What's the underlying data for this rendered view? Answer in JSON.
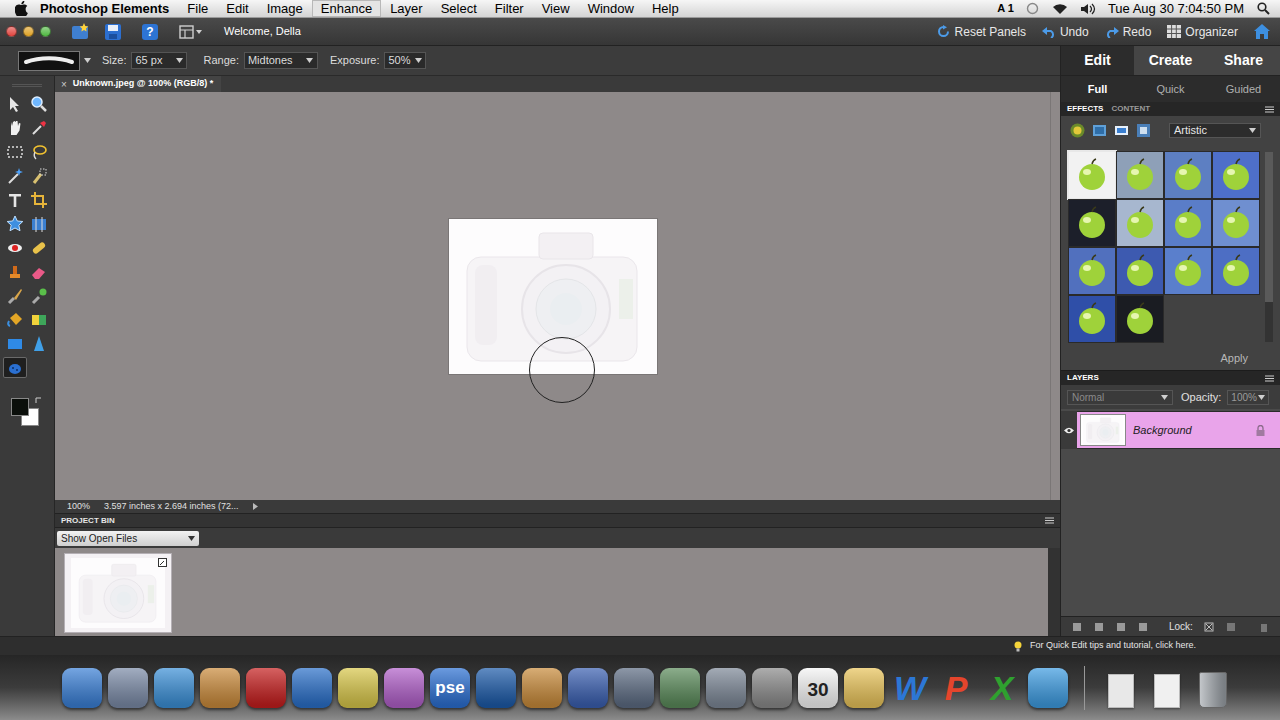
{
  "menubar": {
    "items": [
      {
        "label": "Photoshop Elements",
        "selected": false
      },
      {
        "label": "File",
        "selected": false
      },
      {
        "label": "Edit",
        "selected": false
      },
      {
        "label": "Image",
        "selected": false
      },
      {
        "label": "Enhance",
        "selected": true
      },
      {
        "label": "Layer",
        "selected": false
      },
      {
        "label": "Select",
        "selected": false
      },
      {
        "label": "Filter",
        "selected": false
      },
      {
        "label": "View",
        "selected": false
      },
      {
        "label": "Window",
        "selected": false
      },
      {
        "label": "Help",
        "selected": false
      }
    ],
    "status": "A 1",
    "clock": "Tue Aug 30 7:04:50 PM"
  },
  "app_bar": {
    "help": "?",
    "welcome": "Welcome, Della",
    "reset": "Reset Panels",
    "undo": "Undo",
    "redo": "Redo",
    "organizer": "Organizer"
  },
  "options": {
    "size_label": "Size:",
    "size": "65 px",
    "range_label": "Range:",
    "range": "Midtones",
    "exposure_label": "Exposure:",
    "exposure": "50%"
  },
  "tools": [
    {
      "selected": false
    },
    {
      "selected": false
    },
    {
      "selected": false
    },
    {
      "selected": false
    },
    {
      "selected": false
    },
    {
      "selected": false
    },
    {
      "selected": false
    },
    {
      "selected": false
    },
    {
      "selected": false
    },
    {
      "selected": false
    },
    {
      "selected": false
    },
    {
      "selected": false
    },
    {
      "selected": false
    },
    {
      "selected": false
    },
    {
      "selected": false
    },
    {
      "selected": false
    },
    {
      "selected": false
    },
    {
      "selected": false
    },
    {
      "selected": false
    },
    {
      "selected": false
    },
    {
      "selected": false
    },
    {
      "selected": false
    },
    {
      "selected": true
    }
  ],
  "swatches": {
    "foreground": "#0b0f0b",
    "background": "#ffffff"
  },
  "document": {
    "tab": "Unknown.jpeg @ 100% (RGB/8) *",
    "close": "×",
    "zoom": "100%",
    "info": "3.597 inches x 2.694 inches (72..."
  },
  "project_bin": {
    "title": "PROJECT BIN",
    "show": "Show Open Files",
    "files": [
      {
        "selected": true
      }
    ]
  },
  "tip": "For Quick Edit tips and tutorial, click here.",
  "panel": {
    "modes": [
      {
        "label": "Edit",
        "selected": true
      },
      {
        "label": "Create",
        "selected": false
      },
      {
        "label": "Share",
        "selected": false
      }
    ],
    "edit_modes": [
      {
        "label": "Full",
        "selected": true
      },
      {
        "label": "Quick",
        "selected": false
      },
      {
        "label": "Guided",
        "selected": false
      }
    ],
    "tabs": [
      {
        "label": "EFFECTS",
        "selected": true
      },
      {
        "label": "CONTENT",
        "selected": false
      }
    ],
    "category": "Artistic",
    "effects": [
      {
        "selected": true,
        "color": "#f2f2f2"
      },
      {
        "selected": false,
        "color": "#8ea0b8"
      },
      {
        "selected": false,
        "color": "#5d7fc2"
      },
      {
        "selected": false,
        "color": "#4e6fc9"
      },
      {
        "selected": false,
        "color": "#1c1f2a"
      },
      {
        "selected": false,
        "color": "#a7b7cf"
      },
      {
        "selected": false,
        "color": "#5a7dc8"
      },
      {
        "selected": false,
        "color": "#6f8fd0"
      },
      {
        "selected": false,
        "color": "#5170be"
      },
      {
        "selected": false,
        "color": "#3d5ab0"
      },
      {
        "selected": false,
        "color": "#5a7fcc"
      },
      {
        "selected": false,
        "color": "#4d6ec4"
      },
      {
        "selected": false,
        "color": "#2f4fa8"
      },
      {
        "selected": false,
        "color": "#1a1c22"
      }
    ],
    "apply": "Apply"
  },
  "layers": {
    "title": "LAYERS",
    "blend": "Normal",
    "blend_disabled": true,
    "opacity_label": "Opacity:",
    "opacity": "100%",
    "items": [
      {
        "name": "Background",
        "visible": true,
        "selected": true
      }
    ],
    "lock": "Lock:"
  },
  "dock": [
    {
      "kind": "app",
      "label": "",
      "color": "#3a7fd5"
    },
    {
      "kind": "app",
      "label": "",
      "color": "#7a8aa6"
    },
    {
      "kind": "app",
      "label": "",
      "color": "#3b8fd6"
    },
    {
      "kind": "app",
      "label": "",
      "color": "#c98a3b"
    },
    {
      "kind": "app",
      "label": "",
      "color": "#c41e1e"
    },
    {
      "kind": "app",
      "label": "",
      "color": "#2a6fc8"
    },
    {
      "kind": "app",
      "label": "",
      "color": "#d7c64a"
    },
    {
      "kind": "app",
      "label": "",
      "color": "#b05fc8"
    },
    {
      "kind": "app",
      "label": "pse",
      "color": "#2b6fd1"
    },
    {
      "kind": "app",
      "label": "",
      "color": "#1c5aa8"
    },
    {
      "kind": "app",
      "label": "",
      "color": "#c78a3a"
    },
    {
      "kind": "app",
      "label": "",
      "color": "#3a5fb0"
    },
    {
      "kind": "app",
      "label": "",
      "color": "#5c6b82"
    },
    {
      "kind": "app",
      "label": "",
      "color": "#5a8a5a"
    },
    {
      "kind": "app",
      "label": "",
      "color": "#7c8796"
    },
    {
      "kind": "app",
      "label": "",
      "color": "#8a8a8a"
    },
    {
      "kind": "app",
      "label": "30",
      "color": "#f4f4f4"
    },
    {
      "kind": "app",
      "label": "",
      "color": "#e8c35a"
    },
    {
      "kind": "letter",
      "label": "W",
      "color": "#2c77d6"
    },
    {
      "kind": "letter",
      "label": "P",
      "color": "#e5452c"
    },
    {
      "kind": "letter",
      "label": "X",
      "color": "#2fa12f"
    },
    {
      "kind": "app",
      "label": "",
      "color": "#3d9be0"
    },
    {
      "kind": "stack",
      "label": "",
      "color": "#e8e8e8"
    },
    {
      "kind": "stack",
      "label": "",
      "color": "#f0f0f0"
    },
    {
      "kind": "trash",
      "label": "",
      "color": "#9aa0a6"
    }
  ]
}
